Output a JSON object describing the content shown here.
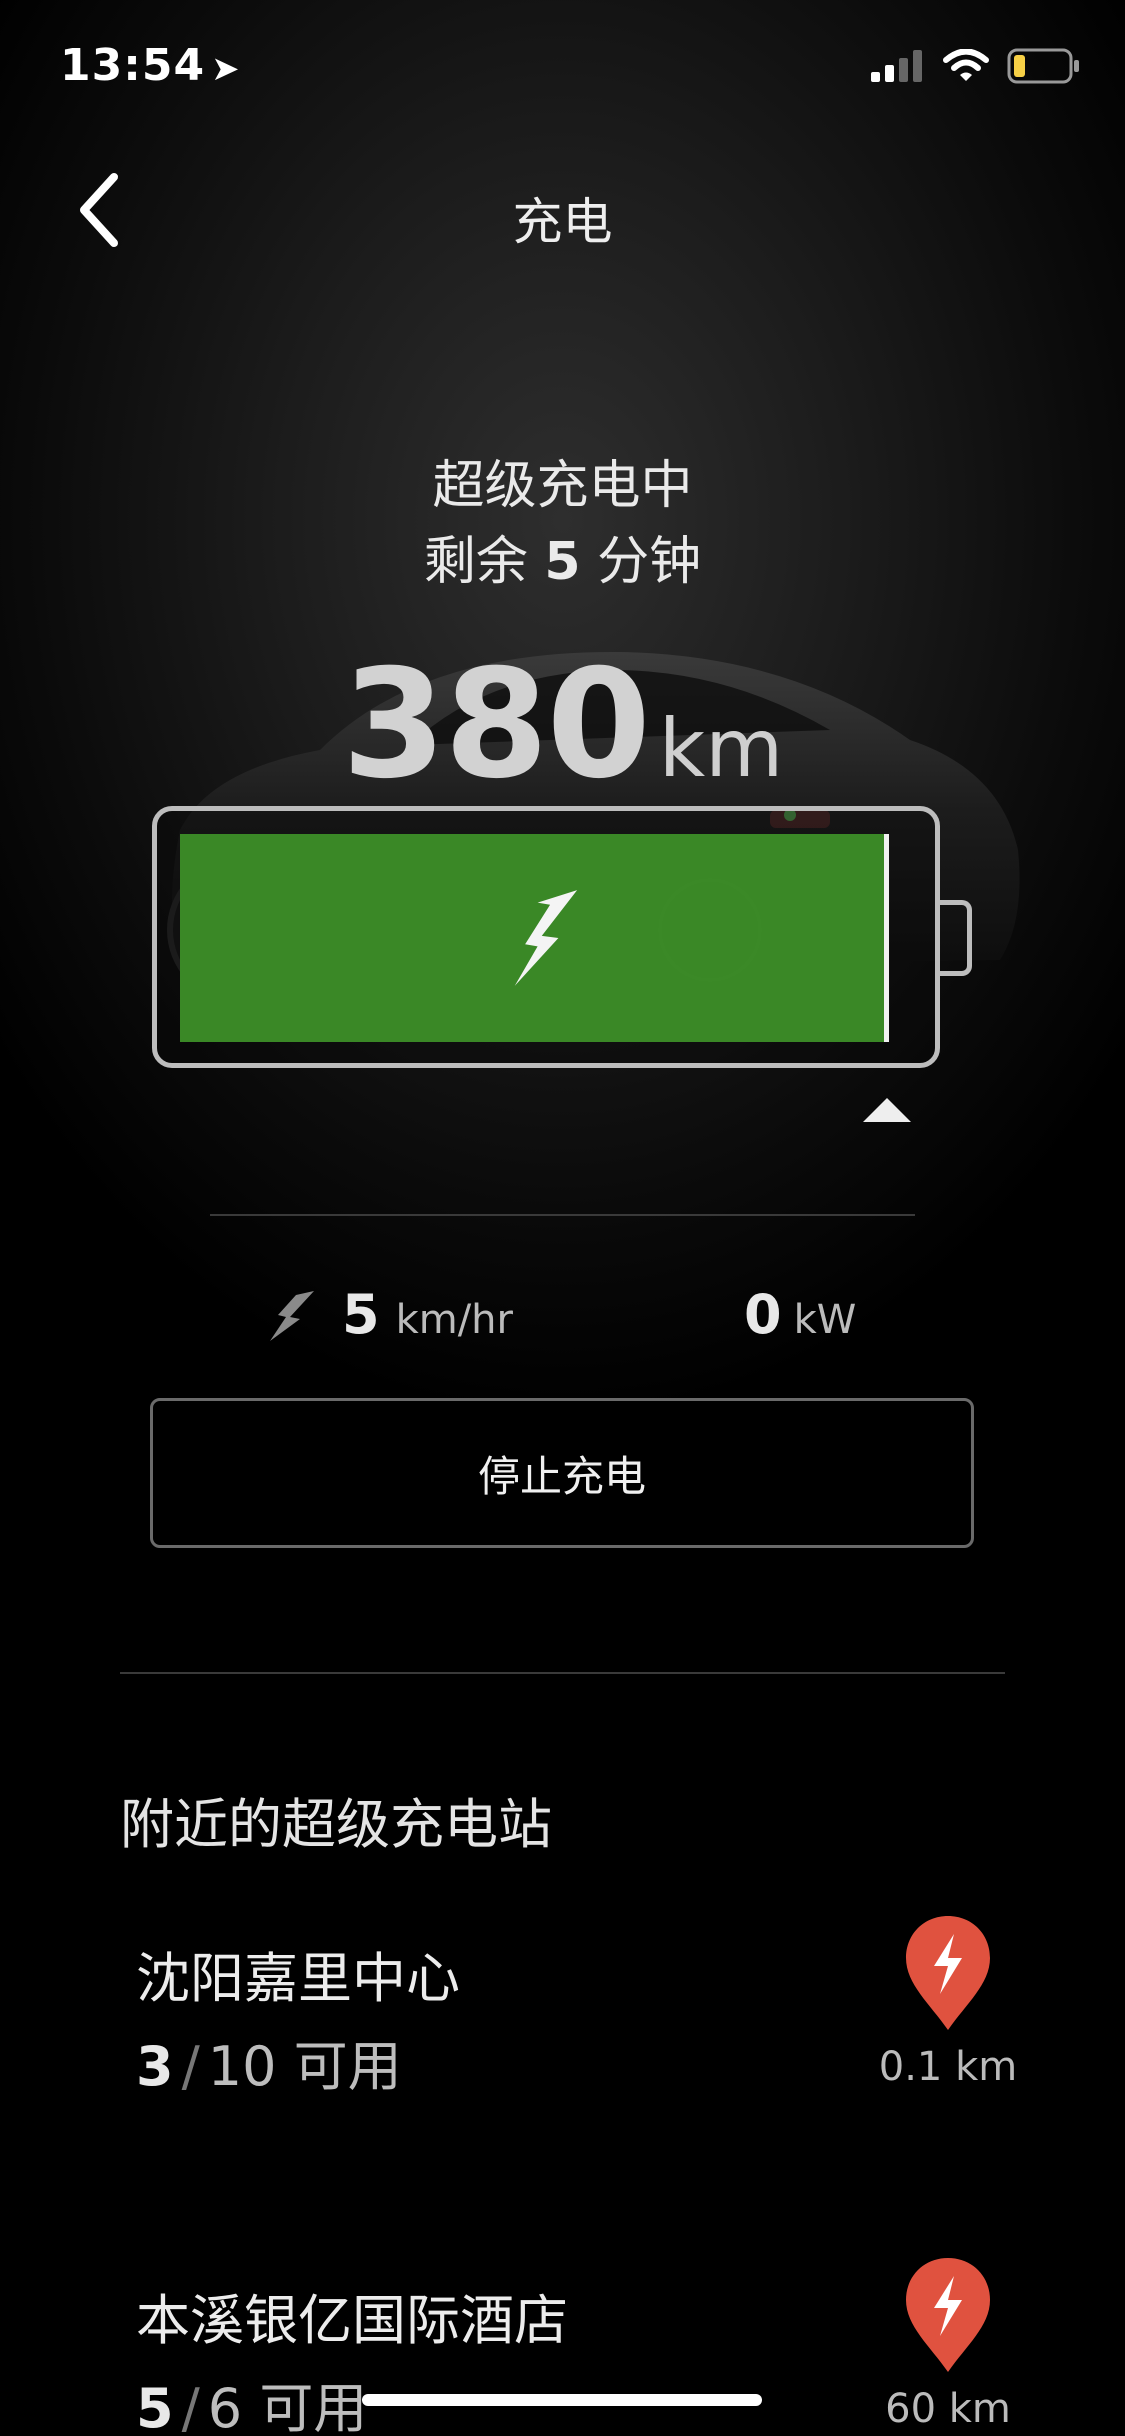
{
  "status_bar": {
    "time": "13:54"
  },
  "header": {
    "title": "充电"
  },
  "charging": {
    "status_line": "超级充电中",
    "remaining_prefix": "剩余",
    "remaining_minutes": "5",
    "remaining_suffix": "分钟"
  },
  "range": {
    "value": "380",
    "unit": "km"
  },
  "battery": {
    "charge_fraction": 0.93,
    "limit_fraction": 0.93,
    "fill_color": "#3c8c27"
  },
  "stats": {
    "rate_value": "5",
    "rate_unit": "km/hr",
    "power_value": "0",
    "power_unit": "kW"
  },
  "stop_button": {
    "label": "停止充电"
  },
  "nearby": {
    "title": "附近的超级充电站",
    "stations": [
      {
        "name": "沈阳嘉里中心",
        "available": "3",
        "total": "10",
        "available_label": "可用",
        "distance": "0.1 km"
      },
      {
        "name": "本溪银亿国际酒店",
        "available": "5",
        "total": "6",
        "available_label": "可用",
        "distance": "60 km"
      }
    ]
  },
  "colors": {
    "pin": "#e0523f",
    "accent_green": "#3c8c27",
    "battery_low": "#f7d046"
  }
}
